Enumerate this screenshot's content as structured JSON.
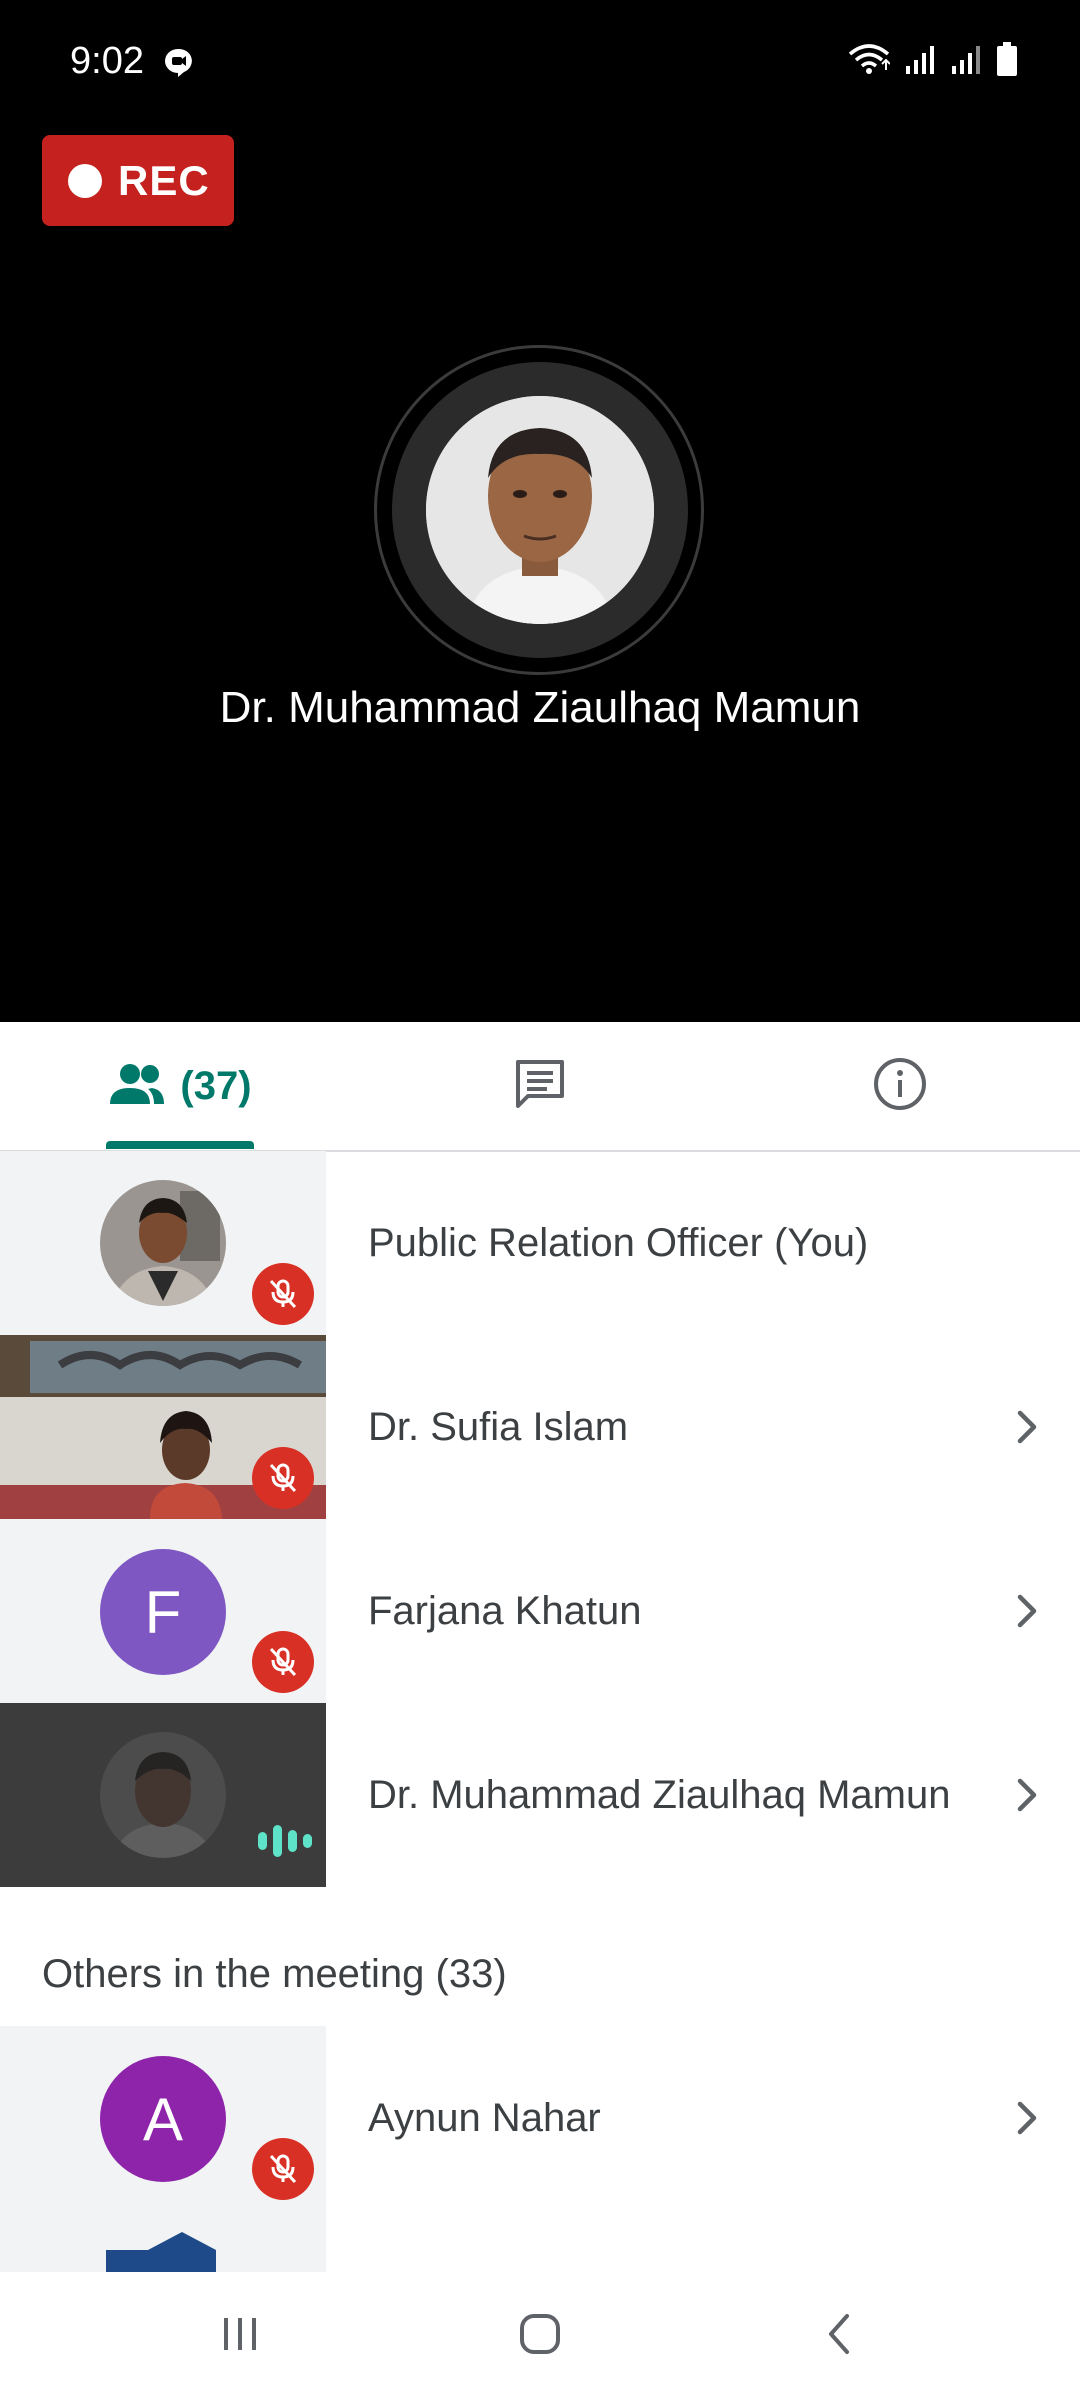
{
  "status_bar": {
    "time": "9:02"
  },
  "recording": {
    "label": "REC"
  },
  "active_speaker": {
    "name": "Dr. Muhammad Ziaulhaq Mamun"
  },
  "tabs": {
    "people_count": "(37)"
  },
  "participants": [
    {
      "name": "Public Relation Officer (You)",
      "muted": true
    },
    {
      "name": "Dr. Sufia Islam",
      "muted": true
    },
    {
      "name": "Farjana Khatun",
      "initial": "F",
      "avatar_color": "#7e57c2",
      "muted": true
    },
    {
      "name": "Dr. Muhammad Ziaulhaq Mamun",
      "speaking": true
    }
  ],
  "others": {
    "title": "Others in the meeting (33)",
    "items": [
      {
        "name": "Aynun Nahar",
        "initial": "A",
        "avatar_color": "#8e24aa",
        "muted": true
      }
    ]
  },
  "colors": {
    "accent": "#00796b",
    "rec": "#c5221f",
    "mic_off": "#d93025",
    "speaking": "#5fe3c8"
  }
}
